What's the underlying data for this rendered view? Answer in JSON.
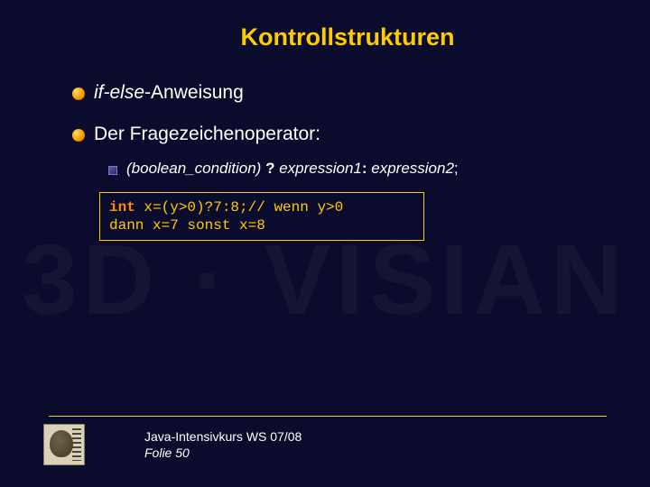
{
  "watermark": "3D · VISIAN",
  "title": "Kontrollstrukturen",
  "bullets": {
    "b1_italic": "if-else",
    "b1_rest": "-Anweisung",
    "b2": "Der Fragezeichenoperator:",
    "sub_cond": "(boolean_condition)",
    "sub_q": " ? ",
    "sub_e1": "expression1",
    "sub_colon": ": ",
    "sub_e2": "expression2",
    "sub_semicolon": ";"
  },
  "code": {
    "kw": "int",
    "line1_rest": " x=(y>0)?7:8;// wenn y>0",
    "line2": "dann x=7 sonst x=8"
  },
  "footer": {
    "course": "Java-Intensivkurs WS 07/08",
    "folie": "Folie 50"
  }
}
